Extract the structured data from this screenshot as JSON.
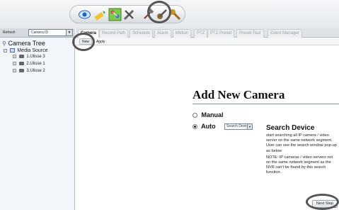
{
  "toolbar": {
    "icons": [
      "eye-icon",
      "pencil-icon",
      "network-icon",
      "tools-icon",
      "hammer-icon",
      "gear-hammer-icon",
      "wrench-icon"
    ]
  },
  "left_panel": {
    "refresh_label": "Refresh",
    "sort_select_value": "Camera ID",
    "tree_title": "Camera Tree",
    "media_source_label": "Media Source",
    "cameras": [
      "1.Ulisse 3",
      "2.Ulisse 1",
      "3.Ulisse 2"
    ]
  },
  "tabs": [
    "Camera",
    "Record Path",
    "Schedule",
    "Alarm",
    "Motion",
    "PTZ",
    "PTZ Preset",
    "Preset Tour",
    "Event Manager"
  ],
  "active_tab": "Camera",
  "actions": {
    "new_label": "New",
    "apply_label": "Apply"
  },
  "main": {
    "heading": "Add New Camera",
    "manual_label": "Manual",
    "auto_label": "Auto",
    "search_select_value": "Search Device",
    "search_title": "Search Device",
    "search_desc": "start searching all IP camera / video server on the same network segment. User can see the search window pop-up as below",
    "note": "NOTE: IP cameras / video servers not on the same network segment as the NVR can't be found by this search function.",
    "next_label": "Next Step"
  },
  "colors": {
    "tree_bg": "#f2f6fb",
    "tab_bar": "#dfe3e8",
    "highlight_circle": "#555555"
  }
}
